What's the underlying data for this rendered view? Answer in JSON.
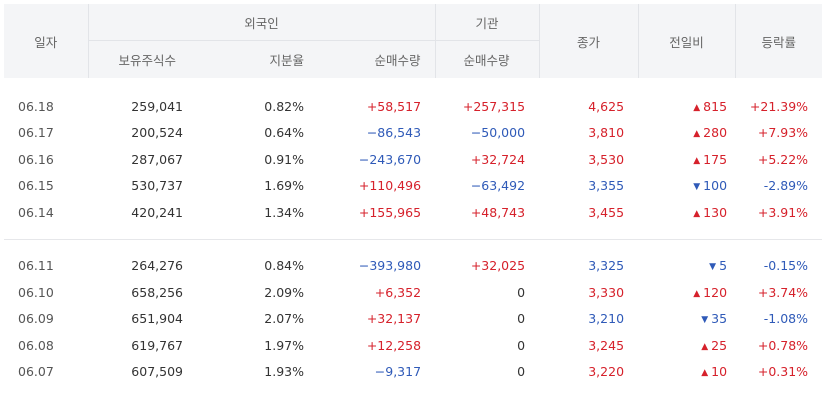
{
  "header": {
    "date": "일자",
    "foreign": "외국인",
    "institution": "기관",
    "close": "종가",
    "change": "전일비",
    "rate": "등락률",
    "holdings": "보유주식수",
    "share": "지분율",
    "foreign_net": "순매수량",
    "inst_net": "순매수량"
  },
  "colors": {
    "up": "#d6212b",
    "down": "#2f5ab8"
  },
  "groups": [
    {
      "rows": [
        {
          "date": "06.18",
          "holdings": "259,041",
          "share": "0.82%",
          "foreign_net": "+58,517",
          "foreign_dir": "up",
          "inst_net": "+257,315",
          "inst_dir": "up",
          "close": "4,625",
          "close_dir": "up",
          "change": "815",
          "change_dir": "up",
          "rate": "+21.39%",
          "rate_dir": "up"
        },
        {
          "date": "06.17",
          "holdings": "200,524",
          "share": "0.64%",
          "foreign_net": "−86,543",
          "foreign_dir": "down",
          "inst_net": "−50,000",
          "inst_dir": "down",
          "close": "3,810",
          "close_dir": "up",
          "change": "280",
          "change_dir": "up",
          "rate": "+7.93%",
          "rate_dir": "up"
        },
        {
          "date": "06.16",
          "holdings": "287,067",
          "share": "0.91%",
          "foreign_net": "−243,670",
          "foreign_dir": "down",
          "inst_net": "+32,724",
          "inst_dir": "up",
          "close": "3,530",
          "close_dir": "up",
          "change": "175",
          "change_dir": "up",
          "rate": "+5.22%",
          "rate_dir": "up"
        },
        {
          "date": "06.15",
          "holdings": "530,737",
          "share": "1.69%",
          "foreign_net": "+110,496",
          "foreign_dir": "up",
          "inst_net": "−63,492",
          "inst_dir": "down",
          "close": "3,355",
          "close_dir": "down",
          "change": "100",
          "change_dir": "down",
          "rate": "-2.89%",
          "rate_dir": "down"
        },
        {
          "date": "06.14",
          "holdings": "420,241",
          "share": "1.34%",
          "foreign_net": "+155,965",
          "foreign_dir": "up",
          "inst_net": "+48,743",
          "inst_dir": "up",
          "close": "3,455",
          "close_dir": "up",
          "change": "130",
          "change_dir": "up",
          "rate": "+3.91%",
          "rate_dir": "up"
        }
      ]
    },
    {
      "rows": [
        {
          "date": "06.11",
          "holdings": "264,276",
          "share": "0.84%",
          "foreign_net": "−393,980",
          "foreign_dir": "down",
          "inst_net": "+32,025",
          "inst_dir": "up",
          "close": "3,325",
          "close_dir": "down",
          "change": "5",
          "change_dir": "down",
          "rate": "-0.15%",
          "rate_dir": "down"
        },
        {
          "date": "06.10",
          "holdings": "658,256",
          "share": "2.09%",
          "foreign_net": "+6,352",
          "foreign_dir": "up",
          "inst_net": "0",
          "inst_dir": "flat",
          "close": "3,330",
          "close_dir": "up",
          "change": "120",
          "change_dir": "up",
          "rate": "+3.74%",
          "rate_dir": "up"
        },
        {
          "date": "06.09",
          "holdings": "651,904",
          "share": "2.07%",
          "foreign_net": "+32,137",
          "foreign_dir": "up",
          "inst_net": "0",
          "inst_dir": "flat",
          "close": "3,210",
          "close_dir": "down",
          "change": "35",
          "change_dir": "down",
          "rate": "-1.08%",
          "rate_dir": "down"
        },
        {
          "date": "06.08",
          "holdings": "619,767",
          "share": "1.97%",
          "foreign_net": "+12,258",
          "foreign_dir": "up",
          "inst_net": "0",
          "inst_dir": "flat",
          "close": "3,245",
          "close_dir": "up",
          "change": "25",
          "change_dir": "up",
          "rate": "+0.78%",
          "rate_dir": "up"
        },
        {
          "date": "06.07",
          "holdings": "607,509",
          "share": "1.93%",
          "foreign_net": "−9,317",
          "foreign_dir": "down",
          "inst_net": "0",
          "inst_dir": "flat",
          "close": "3,220",
          "close_dir": "up",
          "change": "10",
          "change_dir": "up",
          "rate": "+0.31%",
          "rate_dir": "up"
        }
      ]
    }
  ]
}
